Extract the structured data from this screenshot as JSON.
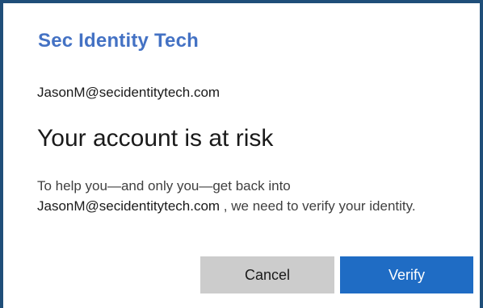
{
  "brand": {
    "name": "Sec Identity Tech",
    "color": "#4472c4"
  },
  "account": {
    "email": "JasonM@secidentitytech.com"
  },
  "dialog": {
    "title": "Your account is at risk",
    "message_before": "To help you—and only you—get back into ",
    "message_email": "JasonM@secidentitytech.com",
    "message_after": " , we need to verify your identity."
  },
  "buttons": {
    "cancel_label": "Cancel",
    "verify_label": "Verify"
  },
  "colors": {
    "frame_border": "#1f4e79",
    "verify_bg": "#1f6cc4",
    "cancel_bg": "#cccccc"
  }
}
